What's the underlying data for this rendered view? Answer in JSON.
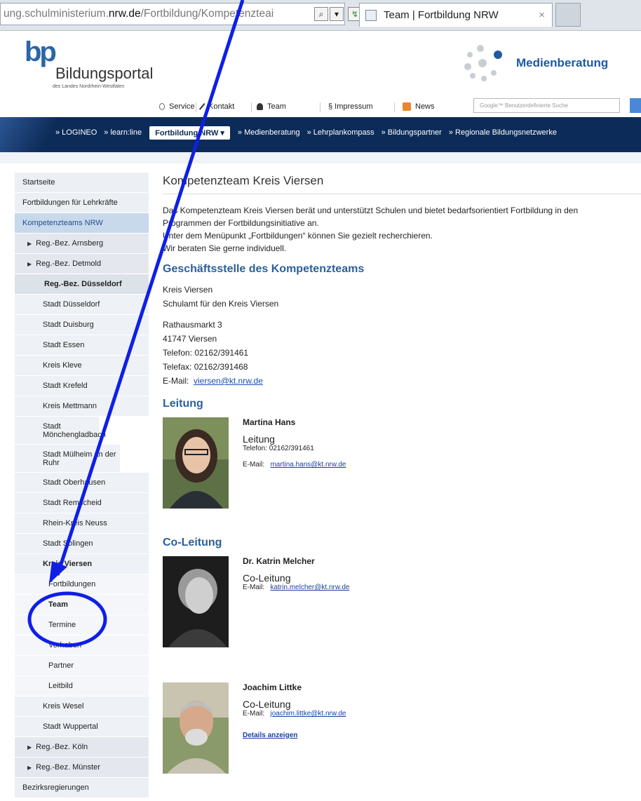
{
  "browser": {
    "url_prefix": "ung.schulministerium.",
    "url_domain": "nrw.de",
    "url_rest": "/Fortbildung/Kompetenzteai",
    "tab_title": "Team | Fortbildung NRW",
    "tab_close": "×"
  },
  "header": {
    "logo_mark": "bp",
    "logo_title": "Bildungsportal",
    "logo_sub": "des Landes Nordrhein-Westfalen",
    "media_title": "Medienberatung",
    "service": {
      "service": "Service",
      "kontakt": "Kontakt",
      "team": "Team",
      "impressum": "§ Impressum",
      "news": "News"
    },
    "search_placeholder": "Google™ Benutzerdefinierte Suche"
  },
  "nav": {
    "items_left": [
      "» LOGINEO",
      "» learn:line"
    ],
    "active": "Fortbildung NRW ▾",
    "items_right": [
      "» Medienberatung",
      "» Lehrplankompass",
      "» Bildungspartner",
      "» Regionale Bildungsnetzwerke"
    ]
  },
  "sidebar": {
    "startseite": "Startseite",
    "fortbildungen": "Fortbildungen für Lehrkräfte",
    "kompetenzteams": "Kompetenzteams NRW",
    "arnsberg": "Reg.-Bez. Arnsberg",
    "detmold": "Reg.-Bez. Detmold",
    "duesseldorf": "Reg.-Bez. Düsseldorf",
    "cities": [
      "Stadt Düsseldorf",
      "Stadt Duisburg",
      "Stadt Essen",
      "Kreis Kleve",
      "Stadt Krefeld",
      "Kreis Mettmann",
      "Stadt Mönchengladbach",
      "Stadt Mülheim an der Ruhr",
      "Stadt Oberhausen",
      "Stadt Remscheid",
      "Rhein-Kreis Neuss",
      "Stadt Solingen"
    ],
    "viersen": "Kreis Viersen",
    "viersen_sub": [
      "Fortbildungen",
      "Team",
      "Termine",
      "Vorhaben",
      "Partner",
      "Leitbild"
    ],
    "cities_after": [
      "Kreis Wesel",
      "Stadt Wuppertal"
    ],
    "koeln": "Reg.-Bez. Köln",
    "muenster": "Reg.-Bez. Münster",
    "bezirksregierungen": "Bezirksregierungen"
  },
  "main": {
    "title": "Kompetenzteam Kreis Viersen",
    "intro_1": "Das Kompetenzteam Kreis Viersen berät und unterstützt Schulen und bietet bedarfsorientiert Fortbildung in den",
    "intro_2": "Programmen der Fortbildungsinitiative an.",
    "intro_3": "Unter dem Menüpunkt „Fortbildungen“ können Sie gezielt recherchieren.",
    "intro_4": "Wir beraten Sie gerne individuell.",
    "office_heading": "Geschäftsstelle des Kompetenzteams",
    "office_1": "Kreis Viersen",
    "office_2": "Schulamt für den Kreis Viersen",
    "street": "Rathausmarkt 3",
    "city": "41747 Viersen",
    "phone": "Telefon: 02162/391461",
    "fax": "Telefax: 02162/391468",
    "email_label": "E-Mail:",
    "email": "viersen@kt.nrw.de",
    "leitung_heading": "Leitung",
    "coleitung_heading": "Co-Leitung",
    "persons": [
      {
        "name": "Martina Hans",
        "role": "Leitung",
        "phone": "Telefon:  02162/391461",
        "email_label": "E-Mail:",
        "email": "martina.hans@kt.nrw.de"
      },
      {
        "name": "Dr. Katrin Melcher",
        "role": "Co-Leitung",
        "email_label": "E-Mail:",
        "email": "katrin.melcher@kt.nrw.de"
      },
      {
        "name": "Joachim  Littke",
        "role": "Co-Leitung",
        "email_label": "E-Mail:",
        "email": "joachim.littke@kt.nrw.de",
        "details": "Details anzeigen"
      }
    ]
  },
  "colors": {
    "nav_bg": "#0c2b58",
    "heading_blue": "#2b5f9c",
    "annotation_blue": "#0f1fe6"
  }
}
